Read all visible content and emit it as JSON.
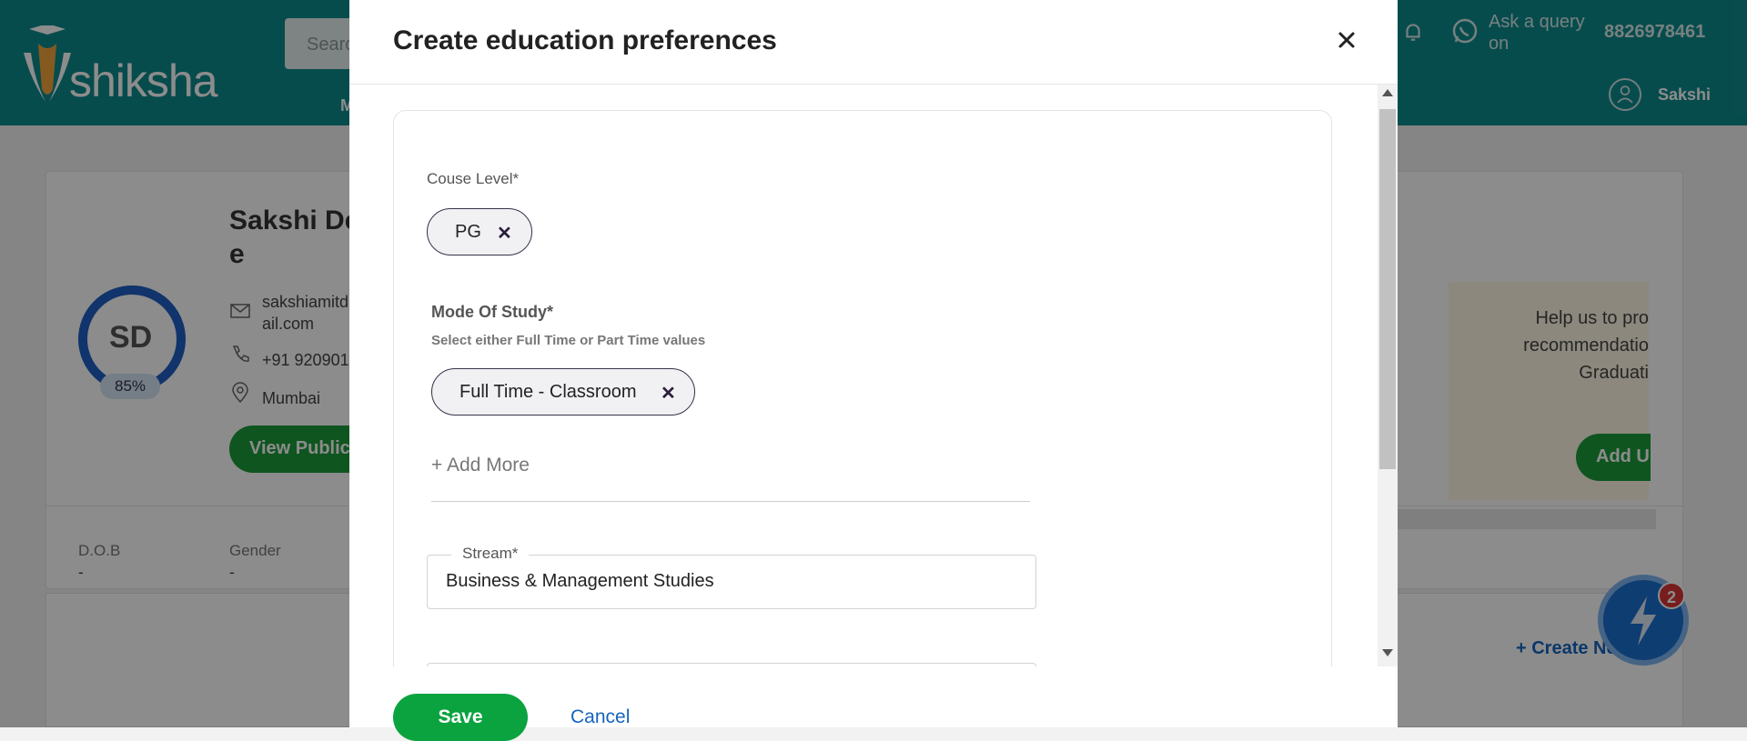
{
  "header": {
    "brand": "shiksha",
    "search_placeholder": "Searc",
    "nav_fragment": "M",
    "ask_query": "Ask a query on",
    "phone": "8826978461",
    "user_name": "Sakshi"
  },
  "profile": {
    "initials": "SD",
    "completion": "85%",
    "name_line1": "Sakshi De",
    "name_line2": "e",
    "email_line1": "sakshiamitd",
    "email_line2": "ail.com",
    "phone": "+91 920901",
    "city": "Mumbai",
    "view_public": "View Public",
    "dob_label": "D.O.B",
    "dob_value": "-",
    "gender_label": "Gender",
    "gender_value": "-"
  },
  "reco": {
    "line1": "Help us to pro",
    "line2": "recommendatio",
    "line3": "Graduati",
    "button": "Add U"
  },
  "create_new": "+ Create Ne",
  "fab_badge": "2",
  "modal": {
    "title": "Create education preferences",
    "course_level_label": "Couse Level*",
    "course_level_chip": "PG",
    "mode_label": "Mode Of Study*",
    "mode_sub": "Select either Full Time or Part Time values",
    "mode_chip": "Full Time - Classroom",
    "add_more": "+ Add More",
    "stream_label": "Stream*",
    "stream_value": "Business & Management Studies",
    "save": "Save",
    "cancel": "Cancel"
  },
  "colors": {
    "header_bg": "#0e8a8c",
    "save_green": "#0aa33f",
    "link_blue": "#1565c0",
    "chip_border": "#3a2f4a"
  }
}
